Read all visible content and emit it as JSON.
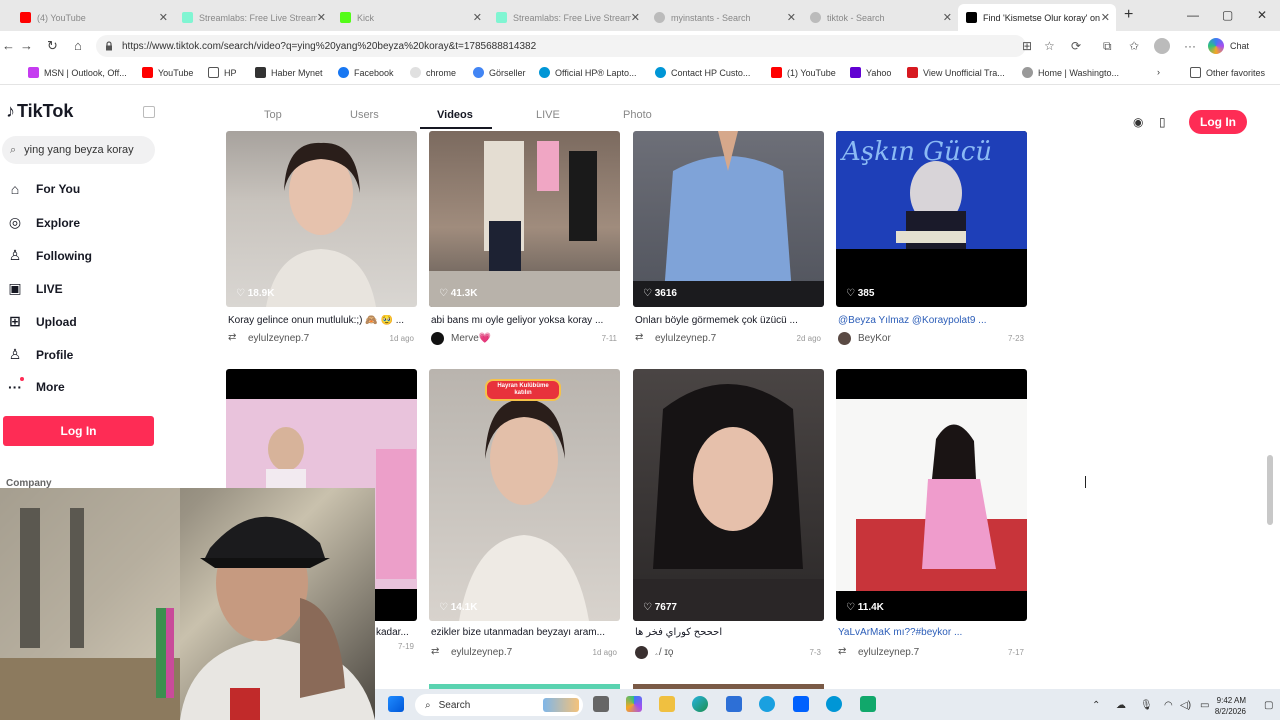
{
  "browser": {
    "tabs": [
      {
        "title": "(4) YouTube",
        "color": "#ff0000"
      },
      {
        "title": "Streamlabs: Free Live Streami",
        "color": "#80f5d2"
      },
      {
        "title": "Kick",
        "color": "#53fc18"
      },
      {
        "title": "Streamlabs: Free Live Streami",
        "color": "#80f5d2"
      },
      {
        "title": "myinstants - Search",
        "color": "#bbbbbb"
      },
      {
        "title": "tiktok - Search",
        "color": "#bbbbbb"
      },
      {
        "title": "Find 'Kismetse Olur koray' on",
        "color": "#000000"
      }
    ],
    "url": "https://www.tiktok.com/search/video?q=ying%20yang%20beyza%20koray&t=1785688814382",
    "chat_label": "Chat",
    "bookmarks": [
      "MSN | Outlook, Off...",
      "YouTube",
      "HP",
      "Haber Mynet",
      "Facebook",
      "chrome",
      "Görseller",
      "Official HP® Lapto...",
      "Contact HP Custo...",
      "(1) YouTube",
      "Yahoo",
      "View Unofficial Tra...",
      "Home | Washingto...",
      "Other favorites"
    ]
  },
  "tiktok": {
    "logo": "TikTok",
    "search_value": "ying yang beyza koray",
    "menu": [
      {
        "label": "For You",
        "icon": "home-icon"
      },
      {
        "label": "Explore",
        "icon": "compass-icon"
      },
      {
        "label": "Following",
        "icon": "person-plus-icon"
      },
      {
        "label": "LIVE",
        "icon": "live-icon"
      },
      {
        "label": "Upload",
        "icon": "plus-square-icon"
      },
      {
        "label": "Profile",
        "icon": "person-icon"
      },
      {
        "label": "More",
        "icon": "more-icon"
      }
    ],
    "login_label": "Log In",
    "company_label": "Company",
    "top_tabs": [
      "Top",
      "Users",
      "Videos",
      "LIVE",
      "Photo"
    ],
    "active_tab": "Videos",
    "accent": "#fe2c55"
  },
  "videos": [
    {
      "likes": "18.9K",
      "caption": "Koray gelince onun mutluluk:;) 🙈 🥹 ...",
      "author": "eylulzeynep.7",
      "date": "1d ago"
    },
    {
      "likes": "41.3K",
      "caption": "abi bans mı oyle geliyor yoksa koray ...",
      "author": "Merve💗",
      "date": "7-11"
    },
    {
      "likes": "3616",
      "caption": "Onları böyle görmemek çok üzücü ...",
      "author": "eylulzeynep.7",
      "date": "2d ago"
    },
    {
      "likes": "385",
      "caption": "@Beyza Yılmaz @Koraypolat9 ...",
      "author": "BeyKor",
      "date": "7-23"
    },
    {
      "likes": "",
      "caption": "kadar...",
      "author": "",
      "date": "7-19"
    },
    {
      "likes": "14.1K",
      "caption": "ezikler bize utanmadan beyzayı aram...",
      "author": "eylulzeynep.7",
      "date": "1d ago"
    },
    {
      "likes": "7677",
      "caption": "احححح كوراي فخر ها",
      "author": "ۦ/ ɪǫ",
      "date": "7-3"
    },
    {
      "likes": "11.4K",
      "caption": "YaLvArMaK mı??#beykor ...",
      "author": "eylulzeynep.7",
      "date": "7-17"
    }
  ],
  "overlay_badge": "Hayran Kulübüme katılın",
  "thumb_text": "Aşkın Gücü",
  "taskbar": {
    "search_label": "Search",
    "time": "9:42 AM",
    "date": "8/2/2026"
  }
}
